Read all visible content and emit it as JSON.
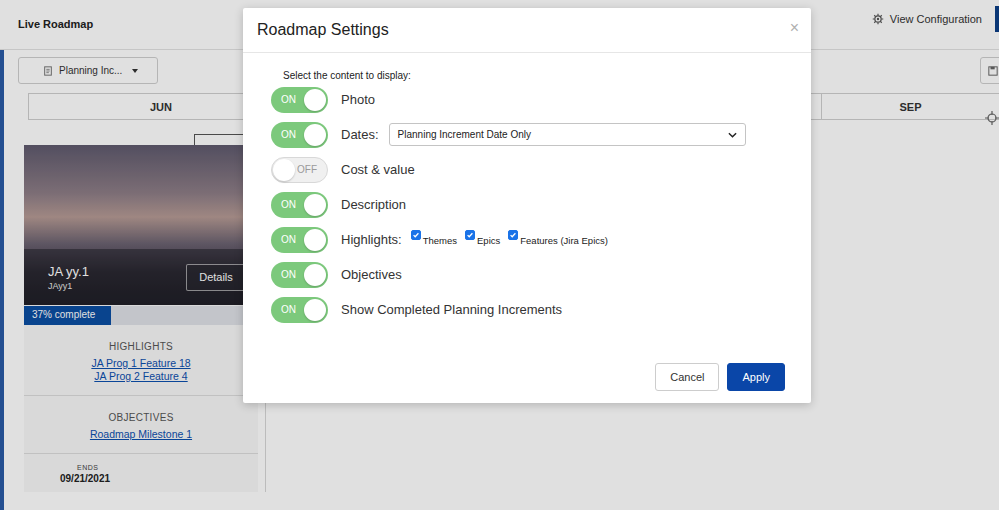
{
  "app": {
    "title": "Live Roadmap",
    "view_configuration": "View Configuration",
    "view_selector": "Planning Inc..."
  },
  "timeline": {
    "months": [
      "JUN",
      "SEP"
    ]
  },
  "card": {
    "title": "JA yy.1",
    "subtitle": "JAyy1",
    "details_button": "Details",
    "progress": {
      "label": "37% complete",
      "level": 0.37
    },
    "highlights": {
      "heading": "HIGHLIGHTS",
      "items": [
        "JA Prog 1 Feature 18",
        "JA Prog 2 Feature 4"
      ]
    },
    "objectives": {
      "heading": "OBJECTIVES",
      "items": [
        "Roadmap Milestone 1"
      ]
    },
    "ends": {
      "label": "ENDS",
      "date": "09/21/2021"
    }
  },
  "dialog": {
    "title": "Roadmap Settings",
    "close": "×",
    "prompt": "Select the content to display:",
    "toggle_text": {
      "on": "ON",
      "off": "OFF"
    },
    "settings": [
      {
        "kind": "plain",
        "label": "Photo",
        "on": true
      },
      {
        "kind": "select",
        "label": "Dates:",
        "on": true,
        "value": "Planning Increment Date Only"
      },
      {
        "kind": "plain",
        "label": "Cost & value",
        "on": false
      },
      {
        "kind": "plain",
        "label": "Description",
        "on": true
      },
      {
        "kind": "checkboxes",
        "label": "Highlights:",
        "on": true,
        "options": [
          {
            "label": "Themes",
            "checked": true
          },
          {
            "label": "Epics",
            "checked": true
          },
          {
            "label": "Features (Jira Epics)",
            "checked": true
          }
        ]
      },
      {
        "kind": "plain",
        "label": "Objectives",
        "on": true
      },
      {
        "kind": "plain",
        "label": "Show Completed Planning Increments",
        "on": true
      }
    ],
    "buttons": [
      {
        "label": "Cancel",
        "primary": false
      },
      {
        "label": "Apply",
        "primary": true
      }
    ]
  }
}
